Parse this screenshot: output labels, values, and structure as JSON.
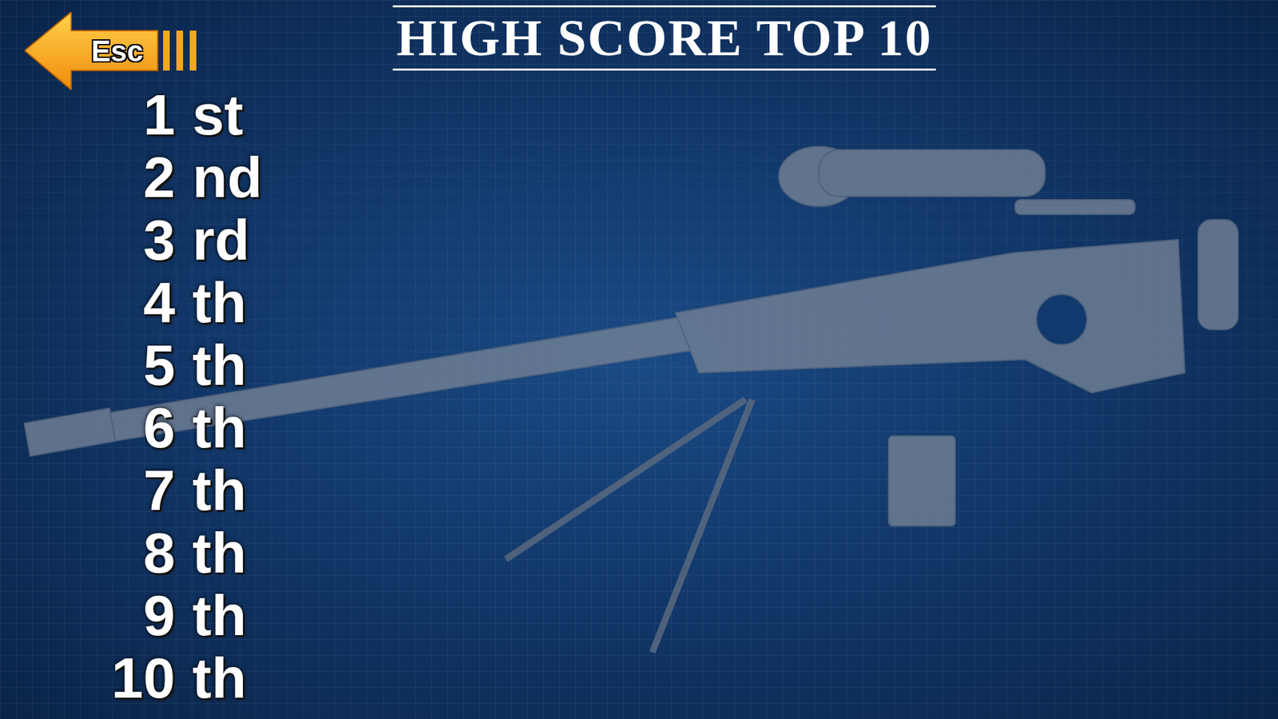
{
  "back_button": {
    "label": "Esc"
  },
  "title": "HIGH SCORE TOP 10",
  "ranks": [
    {
      "number": "1",
      "suffix": "st"
    },
    {
      "number": "2",
      "suffix": "nd"
    },
    {
      "number": "3",
      "suffix": "rd"
    },
    {
      "number": "4",
      "suffix": "th"
    },
    {
      "number": "5",
      "suffix": "th"
    },
    {
      "number": "6",
      "suffix": "th"
    },
    {
      "number": "7",
      "suffix": "th"
    },
    {
      "number": "8",
      "suffix": "th"
    },
    {
      "number": "9",
      "suffix": "th"
    },
    {
      "number": "10",
      "suffix": "th"
    }
  ]
}
